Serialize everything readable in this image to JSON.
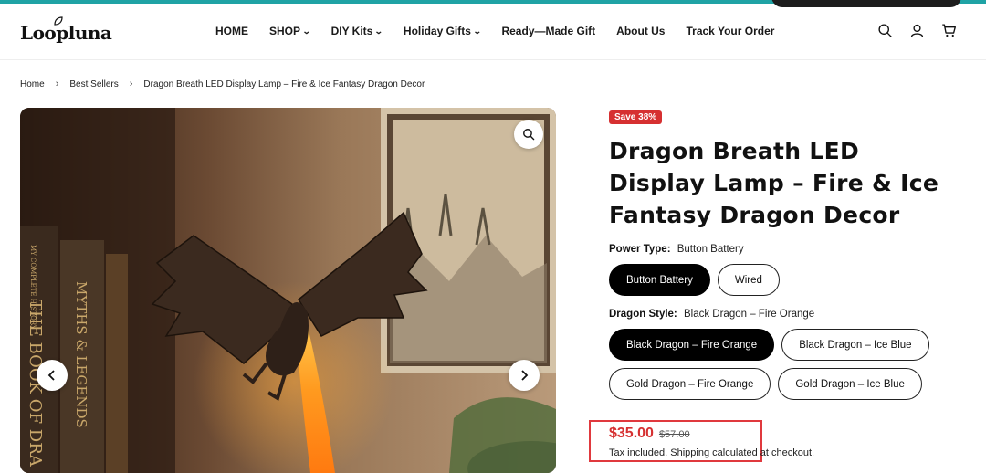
{
  "brand": {
    "logo_text": "Loopluna"
  },
  "nav": {
    "items": [
      {
        "label": "HOME",
        "has_dropdown": false
      },
      {
        "label": "SHOP",
        "has_dropdown": true
      },
      {
        "label": "DIY Kits",
        "has_dropdown": true
      },
      {
        "label": "Holiday Gifts",
        "has_dropdown": true
      },
      {
        "label": "Ready—Made Gift",
        "has_dropdown": false
      },
      {
        "label": "About Us",
        "has_dropdown": false
      },
      {
        "label": "Track Your Order",
        "has_dropdown": false
      }
    ]
  },
  "header_icons": [
    "search-icon",
    "account-icon",
    "cart-icon"
  ],
  "breadcrumb": {
    "items": [
      "Home",
      "Best Sellers",
      "Dragon Breath LED Display Lamp – Fire & Ice Fantasy Dragon Decor"
    ]
  },
  "product": {
    "badge": "Save 38%",
    "title": "Dragon Breath LED Display Lamp – Fire & Ice Fantasy Dragon Decor",
    "options": [
      {
        "name": "Power Type:",
        "selected": "Button Battery",
        "values": [
          "Button Battery",
          "Wired"
        ]
      },
      {
        "name": "Dragon Style:",
        "selected": "Black Dragon – Fire Orange",
        "values": [
          "Black Dragon – Fire Orange",
          "Black Dragon – Ice Blue",
          "Gold Dragon – Fire Orange",
          "Gold Dragon – Ice Blue"
        ]
      }
    ],
    "price": "$35.00",
    "compare_price": "$57.00",
    "tax_prefix": "Tax included.",
    "shipping_link": "Shipping",
    "tax_suffix": "calculated at checkout."
  },
  "gallery": {
    "book_spines": [
      "MY COMPLETE HISTORY",
      "MYTHS & LEGENDS",
      "THE BOOK OF DRA"
    ]
  },
  "colors": {
    "accent": "#1fa3a5",
    "sale": "#d63031",
    "highlight_box": "#e0393e"
  }
}
